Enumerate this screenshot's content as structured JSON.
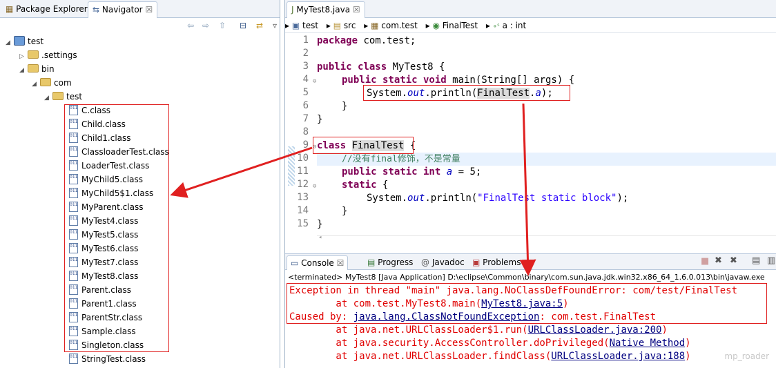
{
  "left_panel": {
    "tabs": [
      "Package Explorer",
      "Navigator"
    ],
    "close_glyph": "☒",
    "tree": {
      "project": "test",
      "settings_folder": ".settings",
      "bin_folder": "bin",
      "com_folder": "com",
      "test_folder": "test",
      "class_files": [
        "C.class",
        "Child.class",
        "Child1.class",
        "ClassloaderTest.class",
        "LoaderTest.class",
        "MyChild5.class",
        "MyChild5$1.class",
        "MyParent.class",
        "MyTest4.class",
        "MyTest5.class",
        "MyTest6.class",
        "MyTest7.class",
        "MyTest8.class",
        "Parent.class",
        "Parent1.class",
        "ParentStr.class",
        "Sample.class",
        "Singleton.class",
        "StringTest.class"
      ]
    }
  },
  "editor": {
    "tab": "MyTest8.java",
    "breadcrumbs": [
      "test",
      "src",
      "com.test",
      "FinalTest",
      "a : int"
    ],
    "line_numbers": [
      "1",
      "2",
      "3",
      "4",
      "5",
      "6",
      "7",
      "8",
      "9",
      "10",
      "11",
      "12",
      "13",
      "14",
      "15"
    ],
    "code": {
      "l1_kw": "package",
      "l1_rest": " com.test;",
      "l3_kw": "public class",
      "l3_rest": " MyTest8 {",
      "l4_kw": "public static void",
      "l4_rest": " main(String[] args) {",
      "l5_a": "System.",
      "l5_out": "out",
      "l5_b": ".println(",
      "l5_final": "FinalTest",
      "l5_dot": ".",
      "l5_a_var": "a",
      "l5_end": ");",
      "l6": "}",
      "l7": "}",
      "l9_kw": "class",
      "l9_name": "FinalTest",
      "l9_brace": " {",
      "l10": "//没有final修饰，不是常量",
      "l11_kw": "public static int",
      "l11_var": "a",
      "l11_rest": " = 5;",
      "l12_kw": "static",
      "l12_rest": " {",
      "l13_a": "System.",
      "l13_out": "out",
      "l13_b": ".println(",
      "l13_str": "\"FinalTest static block\"",
      "l13_end": ");",
      "l14": "}",
      "l15": "}"
    }
  },
  "console": {
    "tabs": [
      "Console",
      "Progress",
      "Javadoc",
      "Problems"
    ],
    "terminated": "<terminated> MyTest8 [Java Application] D:\\eclipse\\Common\\binary\\com.sun.java.jdk.win32.x86_64_1.6.0.013\\bin\\javaw.exe",
    "lines": {
      "l1": "Exception in thread \"main\" java.lang.NoClassDefFoundError: com/test/FinalTest",
      "l2_a": "        at com.test.MyTest8.main(",
      "l2_link": "MyTest8.java:5",
      "l2_b": ")",
      "l3_a": "Caused by: ",
      "l3_link": "java.lang.ClassNotFoundException",
      "l3_b": ": com.test.FinalTest",
      "l4_a": "        at java.net.URLClassLoader$1.run(",
      "l4_link": "URLClassLoader.java:200",
      "l4_b": ")",
      "l5_a": "        at java.security.AccessController.doPrivileged(",
      "l5_link": "Native Method",
      "l5_b": ")",
      "l6_a": "        at java.net.URLClassLoader.findClass(",
      "l6_link": "URLClassLoader.java:188",
      "l6_b": ")"
    }
  },
  "watermark": "mp_roader",
  "colors": {
    "annotation": "#e02020",
    "keyword": "#7f0055",
    "field": "#0000c0",
    "comment": "#3f7f5f",
    "string": "#2a00ff",
    "error": "#e00000"
  }
}
